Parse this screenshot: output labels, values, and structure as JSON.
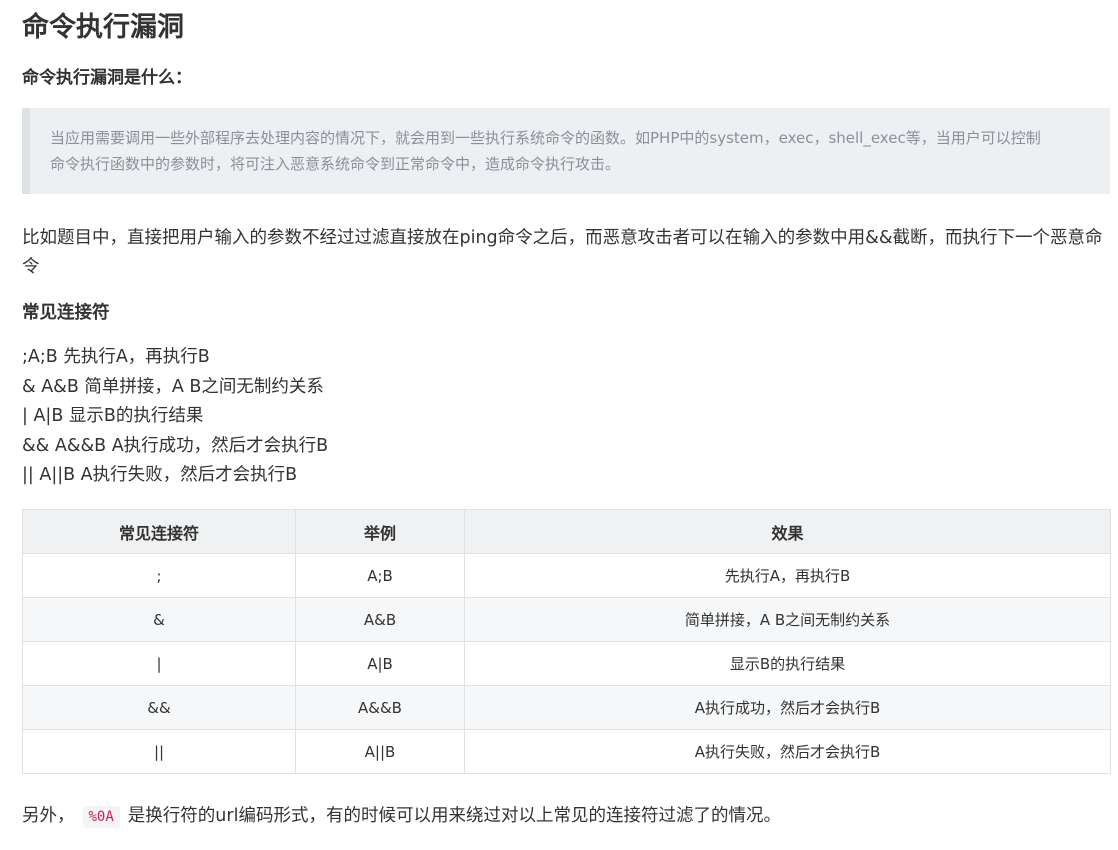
{
  "article": {
    "title": "命令执行漏洞",
    "subtitle": "命令执行漏洞是什么：",
    "quote_line1": "当应用需要调用一些外部程序去处理内容的情况下，就会用到一些执行系统命令的函数。如PHP中的system，exec，shell_exec等，当用户可以控制",
    "quote_line2": "命令执行函数中的参数时，将可注入恶意系统命令到正常命令中，造成命令执行攻击。",
    "paragraph": "比如题目中，直接把用户输入的参数不经过过滤直接放在ping命令之后，而恶意攻击者可以在输入的参数中用&&截断，而执行下一个恶意命令",
    "section_heading": "常见连接符",
    "lines": [
      ";A;B 先执行A，再执行B",
      "& A&B 简单拼接，A B之间无制约关系",
      "| A|B 显示B的执行结果",
      "&& A&&B A执行成功，然后才会执行B",
      "|| A||B A执行失败，然后才会执行B"
    ],
    "footer_before": "另外，",
    "footer_code": "%0A",
    "footer_after": "是换行符的url编码形式，有的时候可以用来绕过对以上常见的连接符过滤了的情况。"
  },
  "table": {
    "headers": [
      "常见连接符",
      "举例",
      "效果"
    ],
    "rows": [
      [
        ";",
        "A;B",
        "先执行A，再执行B"
      ],
      [
        "&",
        "A&B",
        "简单拼接，A B之间无制约关系"
      ],
      [
        "|",
        "A|B",
        "显示B的执行结果"
      ],
      [
        "&&",
        "A&&B",
        "A执行成功，然后才会执行B"
      ],
      [
        "||",
        "A||B",
        "A执行失败，然后才会执行B"
      ]
    ]
  },
  "colors": {
    "text": "#333333",
    "quote_bg": "#eeeff2",
    "quote_text": "#8a8f99",
    "code_text": "#c7254e",
    "table_header_bg": "#eff1f3",
    "table_stripe_bg": "#f6f7f8",
    "border": "#dfe2e5"
  }
}
